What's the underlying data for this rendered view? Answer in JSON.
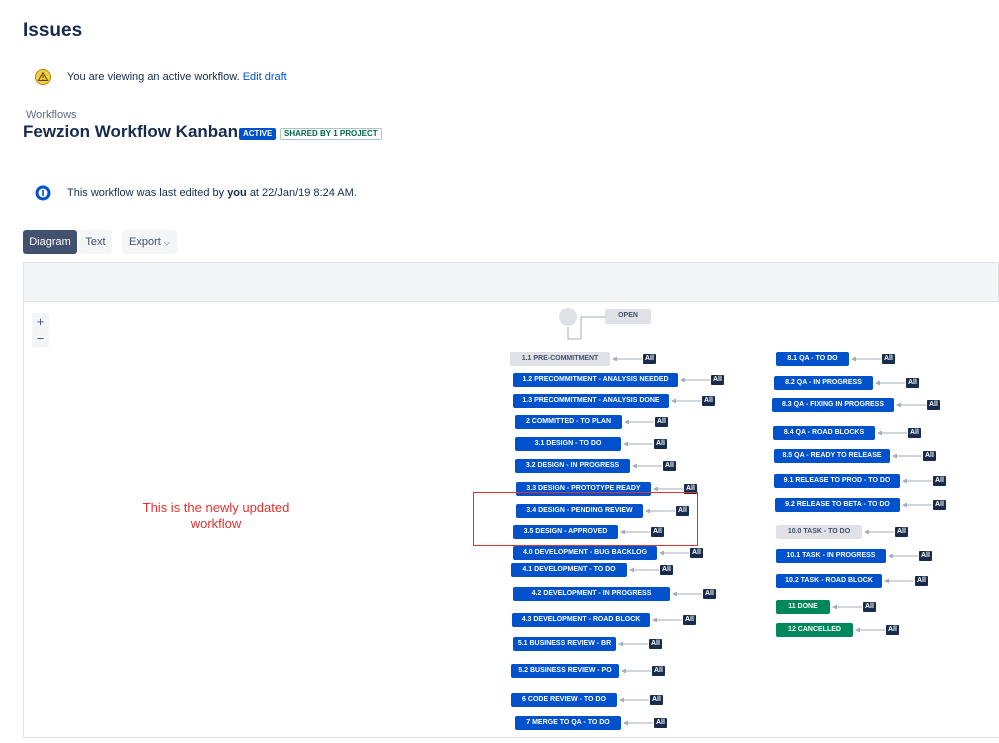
{
  "page": {
    "title": "Issues"
  },
  "notice": {
    "text": "You are viewing an active workflow.",
    "link": "Edit draft"
  },
  "workflow": {
    "breadcrumb": "Workflows",
    "name": "Fewzion Workflow Kanban",
    "status_badge": "ACTIVE",
    "shared_badge": "SHARED BY 1 PROJECT"
  },
  "edit_info": {
    "prefix": "This workflow was last edited by",
    "user": "you",
    "suffix": "at 22/Jan/19 8:24 AM."
  },
  "view_tabs": {
    "diagram": "Diagram",
    "text": "Text",
    "export": "Export"
  },
  "zoom": {
    "in": "+",
    "out": "−"
  },
  "diagram": {
    "open_label": "OPEN",
    "all_label": "All",
    "left_column": [
      {
        "label": "1.1 PRE-COMMITMENT",
        "style": "grey"
      },
      {
        "label": "1.2 PRECOMMITMENT - ANALYSIS NEEDED",
        "style": "blue"
      },
      {
        "label": "1.3 PRECOMMITMENT - ANALYSIS DONE",
        "style": "blue"
      },
      {
        "label": "2 COMMITTED - TO PLAN",
        "style": "blue"
      },
      {
        "label": "3.1 DESIGN - TO DO",
        "style": "blue"
      },
      {
        "label": "3.2 DESIGN - IN PROGRESS",
        "style": "blue"
      },
      {
        "label": "3.3 DESIGN - PROTOTYPE READY",
        "style": "blue"
      },
      {
        "label": "3.4 DESIGN - PENDING REVIEW",
        "style": "blue"
      },
      {
        "label": "3.5 DESIGN - APPROVED",
        "style": "blue"
      },
      {
        "label": "4.0 DEVELOPMENT - BUG BACKLOG",
        "style": "blue"
      },
      {
        "label": "4.1 DEVELOPMENT - TO DO",
        "style": "blue"
      },
      {
        "label": "4.2 DEVELOPMENT - IN PROGRESS",
        "style": "blue"
      },
      {
        "label": "4.3 DEVELOPMENT - ROAD BLOCK",
        "style": "blue"
      },
      {
        "label": "5.1 BUSINESS REVIEW - BR",
        "style": "blue"
      },
      {
        "label": "5.2 BUSINESS REVIEW - PO",
        "style": "blue"
      },
      {
        "label": "6 CODE REVIEW - TO DO",
        "style": "blue"
      },
      {
        "label": "7 MERGE TO QA - TO DO",
        "style": "blue"
      }
    ],
    "right_column": [
      {
        "label": "8.1 QA - TO DO",
        "style": "blue"
      },
      {
        "label": "8.2 QA - IN PROGRESS",
        "style": "blue"
      },
      {
        "label": "8.3 QA - FIXING IN PROGRESS",
        "style": "blue"
      },
      {
        "label": "8.4 QA - ROAD BLOCKS",
        "style": "blue"
      },
      {
        "label": "8.5 QA - READY TO RELEASE",
        "style": "blue"
      },
      {
        "label": "9.1 RELEASE TO PROD - TO DO",
        "style": "blue"
      },
      {
        "label": "9.2 RELEASE TO BETA - TO DO",
        "style": "blue"
      },
      {
        "label": "10.0 TASK - TO DO",
        "style": "grey"
      },
      {
        "label": "10.1 TASK - IN PROGRESS",
        "style": "blue"
      },
      {
        "label": "10.2 TASK - ROAD BLOCK",
        "style": "blue"
      },
      {
        "label": "11 DONE",
        "style": "green"
      },
      {
        "label": "12 CANCELLED",
        "style": "green"
      }
    ]
  },
  "annotation": {
    "text": "This is the newly updated workflow"
  },
  "colors": {
    "status_blue": "#0052cc",
    "status_grey": "#dfe1e6",
    "status_green": "#00875a",
    "annotation_red": "#e5312e"
  }
}
